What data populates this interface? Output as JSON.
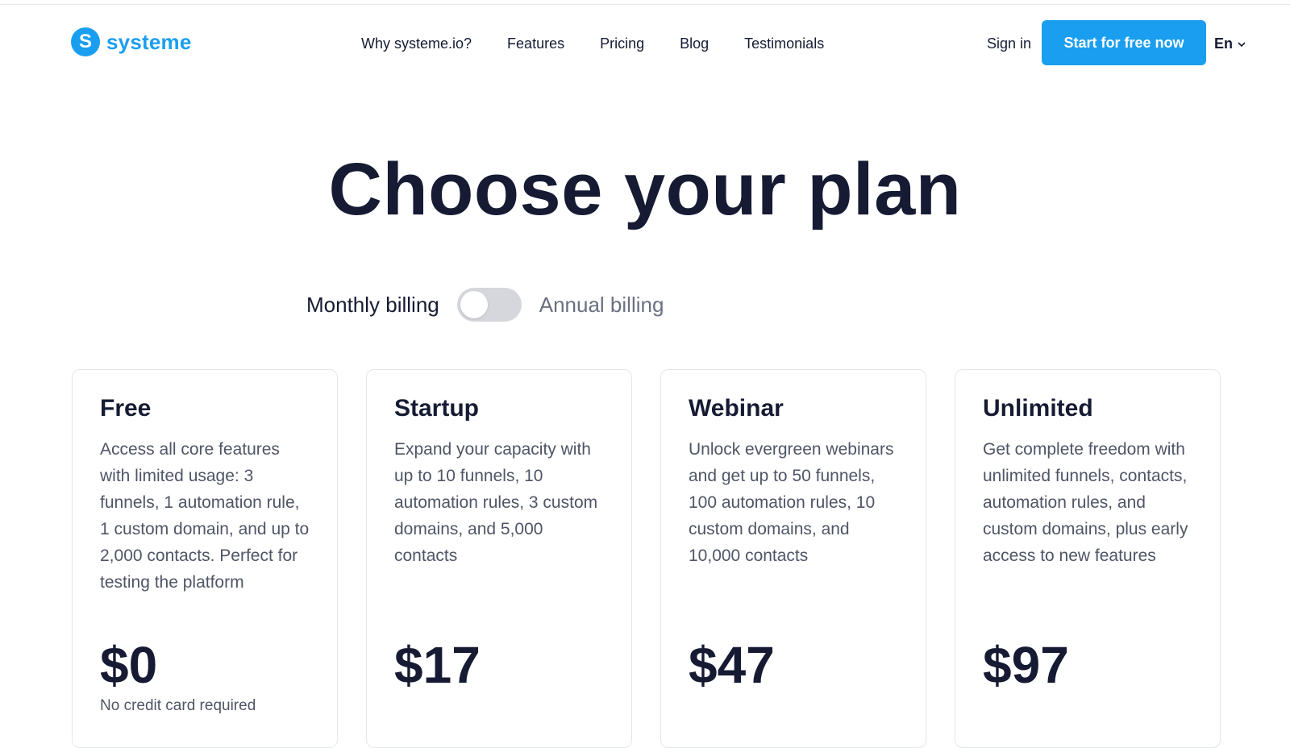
{
  "header": {
    "logo_letter": "S",
    "logo_text": "systeme",
    "nav": [
      "Why systeme.io?",
      "Features",
      "Pricing",
      "Blog",
      "Testimonials"
    ],
    "sign_in": "Sign in",
    "cta": "Start for free now",
    "language": "En"
  },
  "hero": {
    "title": "Choose your plan"
  },
  "billing": {
    "monthly_label": "Monthly billing",
    "annual_label": "Annual billing",
    "annual_enabled": false
  },
  "plans": [
    {
      "name": "Free",
      "description": "Access all core features with limited usage: 3 funnels, 1 automation rule, 1 custom domain, and up to 2,000 contacts. Perfect for testing the platform",
      "price": "$0",
      "note": "No credit card required"
    },
    {
      "name": "Startup",
      "description": "Expand your capacity with up to 10 funnels, 10 automation rules, 3 custom domains, and 5,000 contacts",
      "price": "$17"
    },
    {
      "name": "Webinar",
      "description": "Unlock evergreen webinars and get up to 50 funnels, 100 automation rules, 10 custom domains, and 10,000 contacts",
      "price": "$47"
    },
    {
      "name": "Unlimited",
      "description": "Get complete freedom with unlimited funnels, contacts, automation rules, and custom domains, plus early access to new features",
      "price": "$97"
    }
  ],
  "colors": {
    "brand": "#1a9ef0",
    "text": "#161b33",
    "muted": "#4f5566",
    "toggle_off": "#d5d7dc"
  },
  "icons": {
    "language_dropdown": "chevron-down-icon"
  }
}
